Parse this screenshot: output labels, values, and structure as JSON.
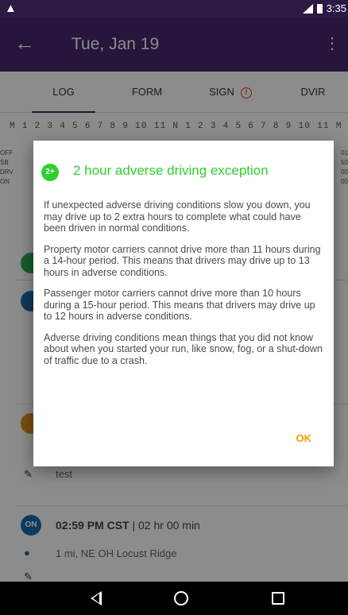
{
  "status_bar": {
    "time": "3:35",
    "network": "4G"
  },
  "app_bar": {
    "title": "Tue, Jan 19"
  },
  "tabs": [
    {
      "label": "LOG",
      "active": true
    },
    {
      "label": "FORM",
      "active": false
    },
    {
      "label": "SIGN",
      "active": false,
      "alert": "!"
    },
    {
      "label": "DVIR",
      "active": false
    }
  ],
  "grid": {
    "hours": "M 1 2 3 4 5 6 7 8 9 10 11 N 1 2 3 4 5 6 7 8 9 10 11 M",
    "rows_left": [
      "OFF",
      "SB",
      "DRV",
      "ON"
    ],
    "rows_right": [
      "01",
      "50",
      "00",
      "00"
    ]
  },
  "events": [
    {
      "chip": "ON",
      "chip_color": "#1e6ba8",
      "time": "02:59 PM CST",
      "separator": "|",
      "duration": "02 hr 00 min",
      "location": "1 mi, NE OH Locust Ridge"
    },
    {
      "note": "test"
    }
  ],
  "dialog": {
    "badge": "2+",
    "title": "2 hour adverse driving exception",
    "title_color": "#2fcf2f",
    "paragraphs": [
      "If unexpected adverse driving conditions slow you down, you may drive up to 2 extra hours to complete what could have been driven in normal conditions.",
      "Property motor carriers cannot drive more than 11 hours during a 14-hour period. This means that drivers may drive up to 13 hours in adverse conditions.",
      "Passenger motor carriers cannot drive more than 10 hours during a 15-hour period. This means that drivers may drive up to 12 hours in adverse conditions.",
      "Adverse driving conditions mean things that you did not know about when you started your run, like snow, fog, or a shut-down of traffic due to a crash."
    ],
    "ok_label": "OK"
  }
}
